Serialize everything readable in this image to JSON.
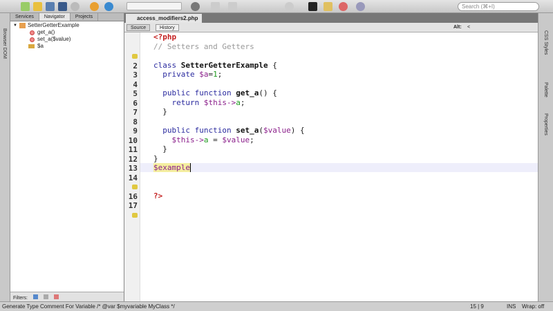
{
  "toolbar": {
    "search_placeholder": "Search (⌘+I)"
  },
  "left_strip": {
    "label": "Browser DOM"
  },
  "navigator": {
    "tabs": [
      "Services",
      "Navigator",
      "Projects"
    ],
    "active_tab": "Navigator",
    "tree": [
      {
        "label": "SetterGetterExample",
        "type": "class"
      },
      {
        "label": "get_a()",
        "type": "method"
      },
      {
        "label": "set_a($value)",
        "type": "method"
      },
      {
        "label": "$a",
        "type": "field"
      }
    ],
    "filters_label": "Filters:"
  },
  "editor": {
    "tab_title": "access_modifiers2.php",
    "source_label": "Source",
    "history_label": "History",
    "alt_label": "Alt:",
    "alt_value": "<",
    "line_numbers": [
      "",
      "2",
      "3",
      "4",
      "5",
      "6",
      "7",
      "8",
      "9",
      "10",
      "11",
      "12",
      "13",
      "14",
      "",
      "16",
      "17",
      ""
    ],
    "lines": [
      "<?php",
      "// Setters and Getters",
      "",
      "class SetterGetterExample {",
      "  private $a=1;",
      "",
      "  public function get_a() {",
      "    return $this->a;",
      "  }",
      "",
      "  public function set_a($value) {",
      "    $this->a = $value;",
      "  }",
      "}",
      "$example",
      "",
      "",
      "?>"
    ]
  },
  "right_strip": [
    "CSS Styles",
    "Palette",
    "Properties"
  ],
  "status": {
    "message": "Generate Type Comment For Variable /* @var $myvariable MyClass */",
    "position": "15 | 9",
    "mode": "INS",
    "wrap": "Wrap: off"
  }
}
